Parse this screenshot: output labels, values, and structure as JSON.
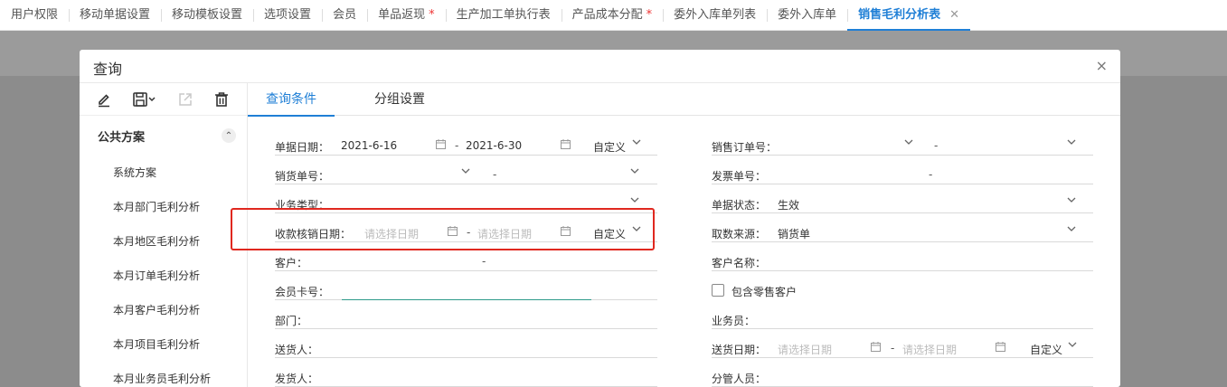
{
  "tabs": [
    {
      "label": "用户权限",
      "starred": false
    },
    {
      "label": "移动单据设置",
      "starred": false
    },
    {
      "label": "移动模板设置",
      "starred": false
    },
    {
      "label": "选项设置",
      "starred": false
    },
    {
      "label": "会员",
      "starred": false
    },
    {
      "label": "单品返现",
      "starred": true
    },
    {
      "label": "生产加工单执行表",
      "starred": false
    },
    {
      "label": "产品成本分配",
      "starred": true
    },
    {
      "label": "委外入库单列表",
      "starred": false
    },
    {
      "label": "委外入库单",
      "starred": false
    },
    {
      "label": "销售毛利分析表",
      "starred": false,
      "active": true
    }
  ],
  "tab_star": "*",
  "tab_close": "✕",
  "dialog": {
    "title": "查询",
    "close": "×"
  },
  "toolbar_icons": [
    "edit-icon",
    "save-icon",
    "export-icon",
    "delete-icon"
  ],
  "left_panel": {
    "group_title": "公共方案",
    "collapse_glyph": "⌃",
    "schemes": [
      "系统方案",
      "本月部门毛利分析",
      "本月地区毛利分析",
      "本月订单毛利分析",
      "本月客户毛利分析",
      "本月项目毛利分析",
      "本月业务员毛利分析"
    ]
  },
  "right_tabs": {
    "conditions": "查询条件",
    "grouping": "分组设置"
  },
  "form": {
    "doc_date": {
      "label": "单据日期：",
      "from": "2021-6-16",
      "to": "2021-6-30",
      "mode": "自定义"
    },
    "sales_order_no": {
      "label": "销售订单号：",
      "sep": "-"
    },
    "delivery_no": {
      "label": "销货单号：",
      "sep": "-"
    },
    "invoice_no": {
      "label": "发票单号：",
      "sep": "-"
    },
    "biz_type": {
      "label": "业务类型："
    },
    "doc_status": {
      "label": "单据状态：",
      "value": "生效"
    },
    "receipt_date": {
      "label": "收款核销日期：",
      "from_placeholder": "请选择日期",
      "to_placeholder": "请选择日期",
      "mode": "自定义"
    },
    "data_source": {
      "label": "取数来源：",
      "value": "销货单"
    },
    "customer": {
      "label": "客户：",
      "sep": "-"
    },
    "customer_name": {
      "label": "客户名称："
    },
    "member_card": {
      "label": "会员卡号："
    },
    "include_retail": {
      "label": "包含零售客户"
    },
    "department": {
      "label": "部门："
    },
    "salesperson": {
      "label": "业务员："
    },
    "deliverer": {
      "label": "送货人："
    },
    "delivery_date": {
      "label": "送货日期：",
      "from_placeholder": "请选择日期",
      "to_placeholder": "请选择日期",
      "mode": "自定义"
    },
    "shipper": {
      "label": "发货人："
    },
    "manager": {
      "label": "分管人员："
    }
  },
  "colors": {
    "accent": "#1f7fd6",
    "highlight": "#e0281f",
    "star": "#e33333"
  }
}
